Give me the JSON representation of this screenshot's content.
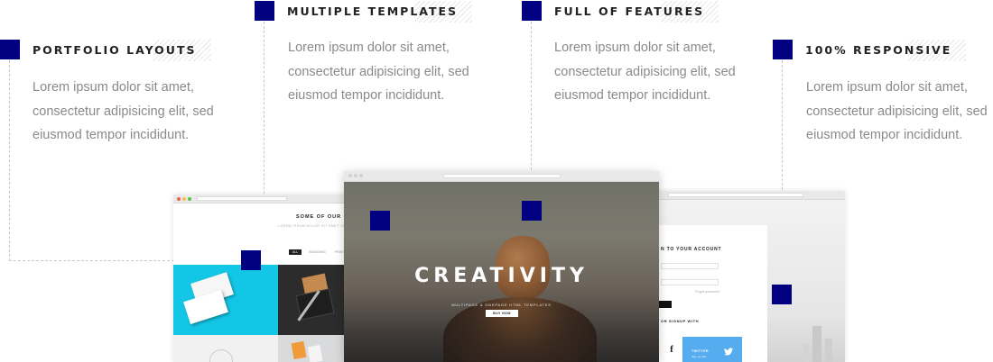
{
  "features": [
    {
      "id": "portfolio",
      "title": "PORTFOLIO LAYOUTS",
      "lines": [
        "Lorem ipsum dolor sit amet,",
        "consectetur adipisicing elit, sed",
        "eiusmod tempor incididunt."
      ]
    },
    {
      "id": "templates",
      "title": "MULTIPLE TEMPLATES",
      "lines": [
        "Lorem ipsum dolor sit amet,",
        "consectetur adipisicing elit, sed",
        "eiusmod tempor incididunt."
      ]
    },
    {
      "id": "features",
      "title": "FULL OF FEATURES",
      "lines": [
        "Lorem ipsum dolor sit amet,",
        "consectetur adipisicing elit, sed",
        "eiusmod tempor incididunt."
      ]
    },
    {
      "id": "responsive",
      "title": "100% RESPONSIVE",
      "lines": [
        "Lorem ipsum dolor sit amet,",
        "consectetur adipisicing elit, sed",
        "eiusmod tempor incididunt."
      ]
    }
  ],
  "left_screen": {
    "heading": "SOME OF OUR PR",
    "subheading": "LOREM IPSUM DOLOR SIT AMET CONS",
    "filters": [
      "ALL",
      "BRANDING",
      "PRINT"
    ]
  },
  "center_screen": {
    "hero_title": "CREATIVITY",
    "hero_subtitle": "MULTIPAGE & ONEPAGE HTML TEMPLATES",
    "cta_label": "BUY NOW"
  },
  "right_screen": {
    "heading": "N TO YOUR ACCOUNT",
    "forgot_label": "Forgot password?",
    "signup_label": "OR SIGNUP WITH",
    "facebook_glyph": "f",
    "twitter_label": "TWITTER",
    "twitter_sub": "Sign up with"
  },
  "colors": {
    "accent": "#000080",
    "twitter": "#55acee"
  }
}
